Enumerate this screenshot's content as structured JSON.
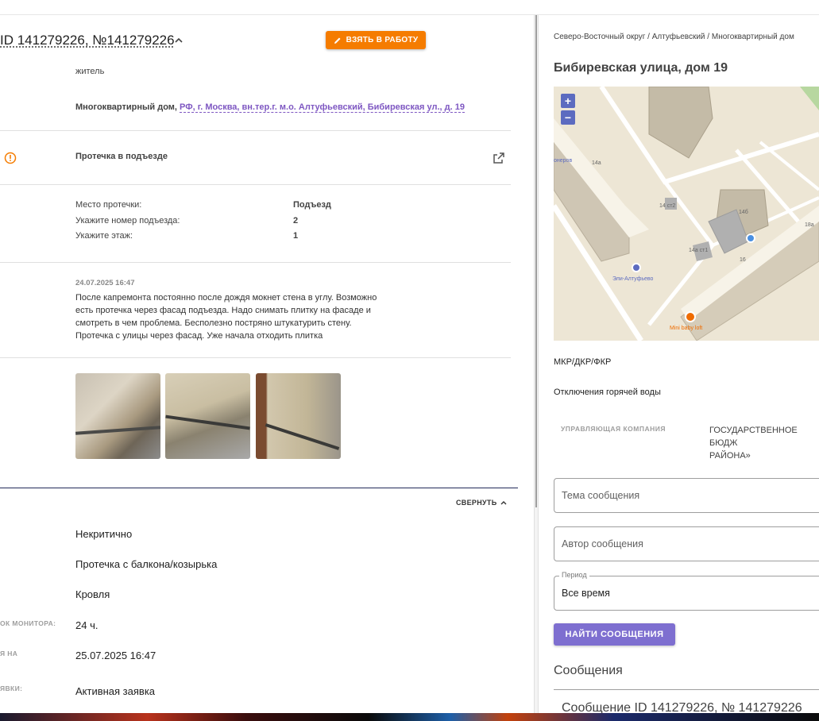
{
  "header": {
    "title": "ID 141279226, №141279226",
    "take_button": "ВЗЯТЬ В РАБОТУ"
  },
  "requester": {
    "role": "житель",
    "building_type": "Многоквартирный дом,",
    "address_link": "РФ, г. Москва, вн.тер.г. м.о. Алтуфьевский, Бибиревская ул., д. 19"
  },
  "issue": {
    "title": "Протечка в подъезде"
  },
  "details": [
    {
      "label": "Место протечки:",
      "value": "Подъезд"
    },
    {
      "label": "Укажите номер подъезда:",
      "value": "2"
    },
    {
      "label": "Укажите этаж:",
      "value": "1"
    }
  ],
  "comment": {
    "date": "24.07.2025 16:47",
    "lines": [
      "После капремонта постоянно после дождя мокнет стена в углу. Возможно",
      "есть протечка через фасад подъезда. Надо снимать плитку на фасаде и",
      "смотреть в чем проблема. Бесполезно постряно штукатурить стену.",
      "Протечка с улицы через фасад. Уже начала отходить плитка"
    ]
  },
  "collapse_label": "СВЕРНУТЬ",
  "info_rows": [
    {
      "label": "",
      "value": "Некритично"
    },
    {
      "label": "",
      "value": "Протечка с балкона/козырька"
    },
    {
      "label": "",
      "value": "Кровля"
    },
    {
      "label": "ОК МОНИТОРА:",
      "value": "24 ч."
    },
    {
      "label": "Я НА",
      "value": "25.07.2025 16:47"
    },
    {
      "label": "ЯВКИ:",
      "value": "Активная заявка"
    }
  ],
  "right": {
    "breadcrumb": "Северо-Восточный округ / Алтуфьевский / Многоквартирный дом",
    "address": "Бибиревская улица, дом 19",
    "map": {
      "zoom_in": "+",
      "zoom_out": "−",
      "labels": [
        "14а",
        "14 ст2",
        "14б",
        "14а ст1",
        "16",
        "18а",
        "Эли-Алтуфьево",
        "Mini baby loft",
        "онеров"
      ]
    },
    "mkr_label": "МКР/ДКР/ФКР",
    "hot_water": "Отключения горячей воды",
    "uk_label": "УПРАВЛЯЮЩАЯ КОМПАНИЯ",
    "uk_value_l1": "ГОСУДАРСТВЕННОЕ БЮДЖ",
    "uk_value_l2": "РАЙОНА»",
    "subject_placeholder": "Тема сообщения",
    "author_placeholder": "Автор сообщения",
    "period_label": "Период",
    "period_value": "Все время",
    "find_button": "НАЙТИ СООБЩЕНИЯ",
    "messages_heading": "Сообщения",
    "message_item": "Сообщение ID 141279226, № 141279226"
  },
  "colors": {
    "accent_orange": "#f57c00",
    "accent_purple": "#7e6fd0",
    "link": "#7e57c2"
  }
}
